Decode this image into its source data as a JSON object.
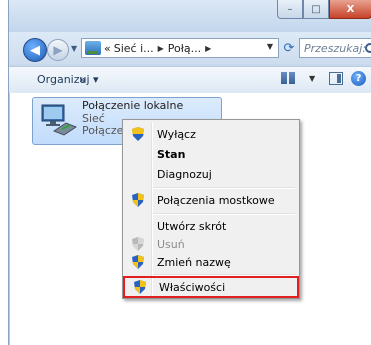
{
  "window": {
    "buttons": {
      "minimize": "–",
      "maximize": "□",
      "close": "X"
    }
  },
  "nav": {
    "breadcrumb": [
      "«",
      "Sieć i...",
      "Połą..."
    ],
    "search_placeholder": "Przeszukaj: Po..."
  },
  "toolbar": {
    "organize": "Organizuj ▾",
    "more": "»"
  },
  "item": {
    "name": "Połączenie lokalne",
    "sub1": "Sieć",
    "sub2": "Połączenie"
  },
  "context_menu": {
    "items": [
      {
        "label": "Wyłącz",
        "shield": true,
        "bold": false,
        "disabled": false
      },
      {
        "label": "Stan",
        "shield": false,
        "bold": true,
        "disabled": false
      },
      {
        "label": "Diagnozuj",
        "shield": false,
        "bold": false,
        "disabled": false
      },
      {
        "label": "Połączenia mostkowe",
        "shield": true,
        "bold": false,
        "disabled": false
      },
      {
        "label": "Utwórz skrót",
        "shield": false,
        "bold": false,
        "disabled": false
      },
      {
        "label": "Usuń",
        "shield": true,
        "bold": false,
        "disabled": true
      },
      {
        "label": "Zmień nazwę",
        "shield": true,
        "bold": false,
        "disabled": false
      },
      {
        "label": "Właściwości",
        "shield": true,
        "bold": false,
        "disabled": false,
        "highlighted": true
      }
    ]
  },
  "colors": {
    "highlight_border": "#e02020",
    "selection": "#c1dcfc",
    "shield_blue": "#2a62c0",
    "shield_yellow": "#f3c21a"
  }
}
